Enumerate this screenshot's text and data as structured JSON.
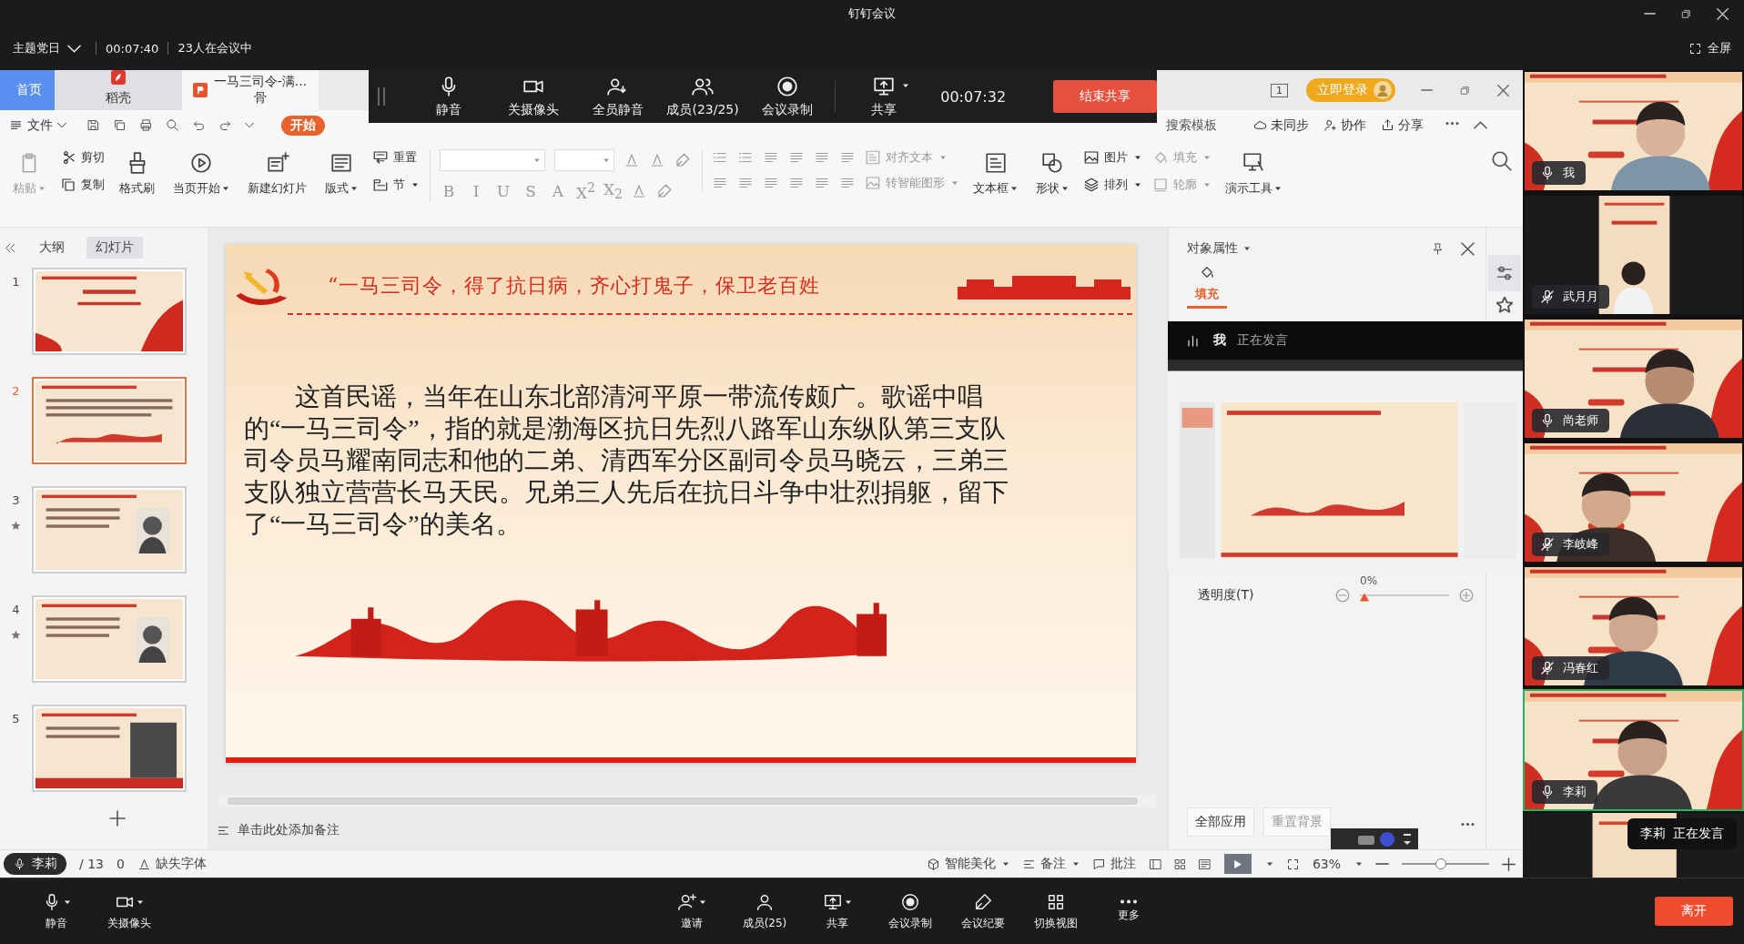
{
  "window": {
    "title": "钉钉会议"
  },
  "meeting_bar": {
    "topic": "主题党日",
    "elapsed": "00:07:40",
    "attendance": "23人在会议中",
    "fullscreen": "全屏"
  },
  "wps": {
    "tabs": [
      {
        "label": "首页",
        "kind": "home",
        "selected": false
      },
      {
        "label": "稻壳",
        "kind": "app",
        "selected": false
      },
      {
        "label": "一马三司令-满...骨",
        "kind": "doc",
        "selected": true
      }
    ],
    "page_indicator": "1",
    "login_button": "立即登录",
    "share_toolbar": {
      "items": [
        {
          "label": "静音"
        },
        {
          "label": "关摄像头"
        },
        {
          "label": "全员静音"
        },
        {
          "label": "成员(23/25)"
        },
        {
          "label": "会议录制"
        },
        {
          "label": "共享"
        }
      ],
      "timer": "00:07:32",
      "stop_button": "结束共享"
    },
    "menu": {
      "file": "文件",
      "tabs": [
        {
          "label": "开始",
          "selected": true
        }
      ],
      "search": "搜索模板",
      "actions": [
        "未同步",
        "协作",
        "分享"
      ]
    },
    "ribbon": [
      {
        "kind": "large",
        "label": "粘贴",
        "disabled": true,
        "dropdown": true
      },
      {
        "kind": "stack",
        "items": [
          {
            "label": "剪切",
            "disabled": false,
            "dropdown": false
          },
          {
            "label": "复制",
            "disabled": false,
            "dropdown": false
          }
        ]
      },
      {
        "kind": "large",
        "label": "格式刷",
        "disabled": false,
        "dropdown": false
      },
      {
        "kind": "large",
        "label": "当页开始",
        "disabled": false,
        "dropdown": true
      },
      {
        "kind": "large",
        "label": "新建幻灯片",
        "disabled": false,
        "dropdown": false
      },
      {
        "kind": "large",
        "label": "版式",
        "disabled": false,
        "dropdown": true
      },
      {
        "kind": "stack",
        "items": [
          {
            "label": "重置",
            "disabled": false,
            "dropdown": false
          },
          {
            "label": "节",
            "disabled": false,
            "dropdown": true
          }
        ]
      },
      {
        "kind": "font",
        "glyphs": [
          "B",
          "I",
          "U",
          "S",
          "A",
          "X$^{2}$",
          "X$_{2}$"
        ]
      },
      {
        "kind": "paragraph",
        "items": [
          {
            "label": "对齐文本",
            "disabled": true,
            "dropdown": true
          },
          {
            "label": "转智能图形",
            "disabled": true,
            "dropdown": true
          }
        ]
      },
      {
        "kind": "large",
        "label": "文本框",
        "disabled": false,
        "dropdown": true
      },
      {
        "kind": "large",
        "label": "形状",
        "disabled": false,
        "dropdown": true
      },
      {
        "kind": "stack",
        "items": [
          {
            "label": "图片",
            "disabled": false,
            "dropdown": true
          },
          {
            "label": "排列",
            "disabled": false,
            "dropdown": true
          }
        ]
      },
      {
        "kind": "stack",
        "items": [
          {
            "label": "填充",
            "disabled": true,
            "dropdown": true
          },
          {
            "label": "轮廓",
            "disabled": true,
            "dropdown": true
          }
        ]
      },
      {
        "kind": "large",
        "label": "演示工具",
        "disabled": false,
        "dropdown": true
      }
    ],
    "pane_tabs": [
      {
        "label": "大纲",
        "selected": false
      },
      {
        "label": "幻灯片",
        "selected": true
      }
    ],
    "slides": [
      {
        "number": "1",
        "selected": false,
        "starred": false
      },
      {
        "number": "2",
        "selected": true,
        "starred": false
      },
      {
        "number": "3",
        "selected": false,
        "starred": true
      },
      {
        "number": "4",
        "selected": false,
        "starred": true
      },
      {
        "number": "5",
        "selected": false,
        "starred": false
      }
    ],
    "slide": {
      "title": "“一马三司令，得了抗日病，齐心打鬼子，保卫老百姓",
      "body": "这首民谣，当年在山东北部清河平原一带流传颇广。歌谣中唱的“一马三司令”，指的就是渤海区抗日先烈八路军山东纵队第三支队司令员马耀南同志和他的二弟、清西军分区副司令员马晓云，三弟三支队独立营营长马天民。兄弟三人先后在抗日斗争中壮烈捐躯，留下了“一马三司令”的美名。"
    },
    "notes_placeholder": "单击此处添加备注",
    "properties": {
      "title": "对象属性",
      "tab": "填充",
      "transparency_label": "透明度(T)",
      "transparency_value": "0%",
      "level": 0,
      "buttons": [
        {
          "label": "全部应用",
          "disabled": false
        },
        {
          "label": "重置背景",
          "disabled": true
        }
      ]
    },
    "speaker_overlay": {
      "name": "我",
      "status": "正在发言"
    },
    "status_bar": {
      "speaker": "李莉",
      "page": "/ 13",
      "count": "0",
      "missing_fonts": "缺失字体",
      "beautify": "智能美化",
      "notes": "备注",
      "comments": "批注",
      "zoom": "63%",
      "level": 0.45
    }
  },
  "video_tiles": [
    {
      "name": "我",
      "muted": false,
      "active": false,
      "kind": "wide"
    },
    {
      "name": "武月月",
      "muted": true,
      "active": false,
      "kind": "portrait"
    },
    {
      "name": "尚老师",
      "muted": false,
      "active": false,
      "kind": "wide"
    },
    {
      "name": "李岐峰",
      "muted": true,
      "active": false,
      "kind": "wide"
    },
    {
      "name": "冯春红",
      "muted": true,
      "active": false,
      "kind": "wide"
    },
    {
      "name": "李莉",
      "muted": false,
      "active": true,
      "kind": "wide"
    }
  ],
  "speaking_toast": {
    "name": "李莉",
    "status": "正在发言"
  },
  "bottom_toolbar": {
    "left": [
      {
        "label": "静音"
      },
      {
        "label": "关摄像头"
      }
    ],
    "center": [
      {
        "label": "邀请"
      },
      {
        "label": "成员(25)"
      },
      {
        "label": "共享"
      },
      {
        "label": "会议录制"
      },
      {
        "label": "会议纪要"
      },
      {
        "label": "切换视图"
      },
      {
        "label": "更多"
      }
    ],
    "leave_button": "离开"
  }
}
